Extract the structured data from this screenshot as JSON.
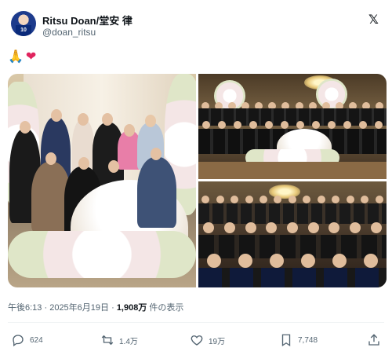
{
  "author": {
    "display_name": "Ritsu Doan/堂安 律",
    "handle": "@doan_ritsu",
    "avatar_jersey": "10"
  },
  "platform_icon": "x-logo-icon",
  "post": {
    "text_emojis": [
      "🙏",
      "❤"
    ]
  },
  "meta": {
    "time": "午後6:13",
    "separator": " · ",
    "date": "2025年6月19日",
    "views_count": "1,908万",
    "views_suffix": " 件の表示"
  },
  "actions": {
    "reply": {
      "icon": "reply-icon",
      "count": "624"
    },
    "repost": {
      "icon": "repost-icon",
      "count": "1.4万"
    },
    "like": {
      "icon": "heart-icon",
      "count": "19万"
    },
    "bookmark": {
      "icon": "bookmark-icon",
      "count": "7,748"
    },
    "share": {
      "icon": "share-icon"
    }
  },
  "colors": {
    "text_primary": "#0f1419",
    "text_secondary": "#536471",
    "divider": "#eff3f4",
    "heart": "#e0245e"
  }
}
